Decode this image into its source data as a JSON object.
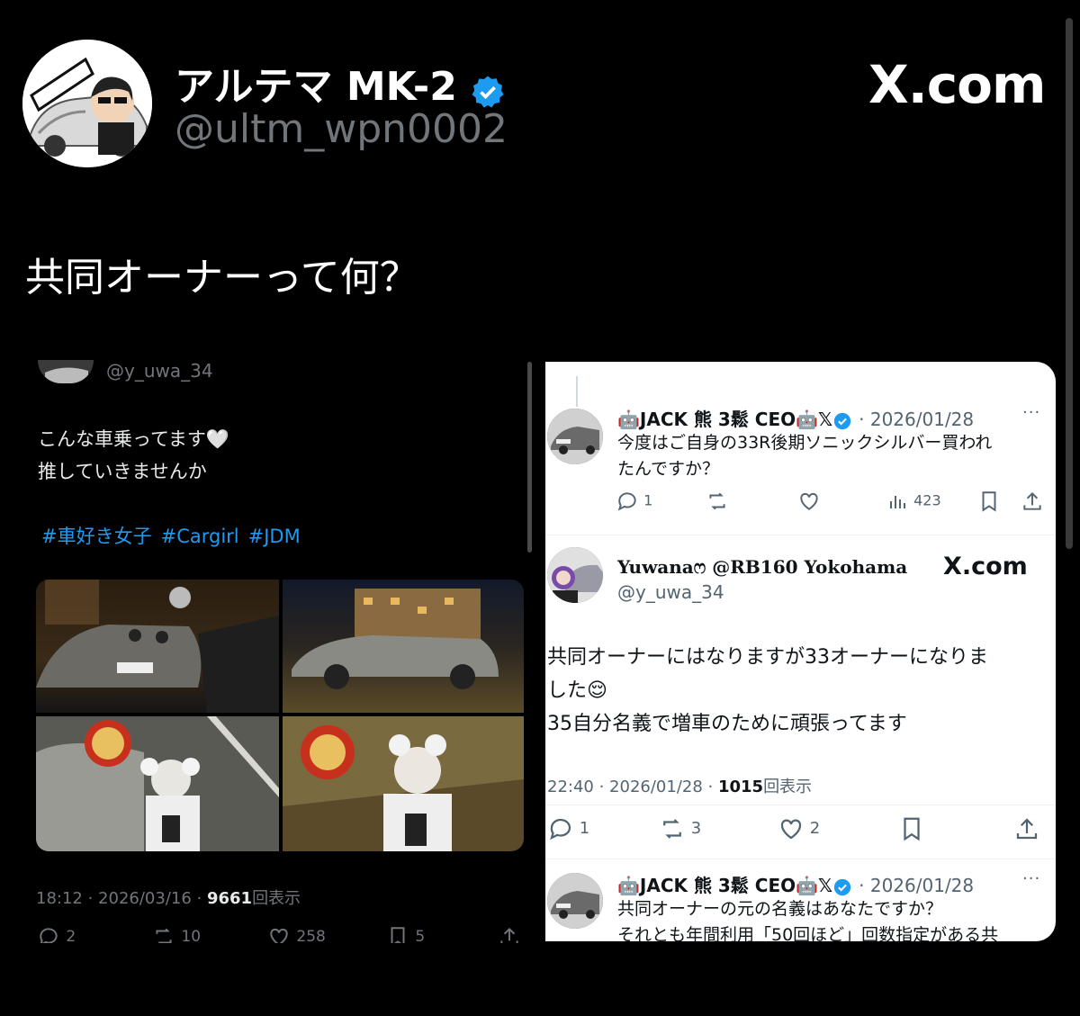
{
  "header": {
    "display_name": "アルテマ MK-2",
    "handle": "@ultm_wpn0002",
    "site_label": "X.com",
    "avatar_text": "アルテマ"
  },
  "tweet": {
    "text": "共同オーナーって何？"
  },
  "left_embed": {
    "handle": "@y_uwa_34",
    "lines": [
      "こんな車乗ってます🤍",
      "推していきませんか"
    ],
    "hashtags": [
      "#車好き女子",
      "#Cargirl",
      "#JDM"
    ],
    "time": "18:12 · 2026/03/16 · ",
    "views_count": "9661",
    "views_label": "回表示",
    "actions": {
      "replies": "2",
      "reposts": "10",
      "likes": "258",
      "bookmarks": "5"
    }
  },
  "right_embed": {
    "reply1": {
      "name": "🤖JACK 熊 3鬆 CEO🤖𝕏",
      "date": "· 2026/01/28",
      "lines": [
        "今度はご自身の33R後期ソニックシルバー買われ",
        "たんですか？"
      ],
      "replies": "1",
      "views": "423"
    },
    "main": {
      "name": "Yuwanaෆ @RB160 Yokohama",
      "handle": "@y_uwa_34",
      "site_label": "X.com",
      "lines": [
        "共同オーナーにはなりますが33オーナーになりま",
        "した😌",
        "35自分名義で増車のために頑張ってます"
      ],
      "time": "22:40 · 2026/01/28 · ",
      "views_count": "1015",
      "views_label": "回表示",
      "replies": "1",
      "reposts": "3",
      "likes": "2"
    },
    "reply2": {
      "name": "🤖JACK 熊 3鬆 CEO🤖𝕏",
      "date": "· 2026/01/28",
      "lines": [
        "共同オーナーの元の名義はあなたですか？",
        "それとも年間利用「50回ほど」回数指定がある共"
      ]
    }
  },
  "colors": {
    "accent": "#1d9bf0",
    "background": "#000000",
    "muted": "#71767b"
  }
}
